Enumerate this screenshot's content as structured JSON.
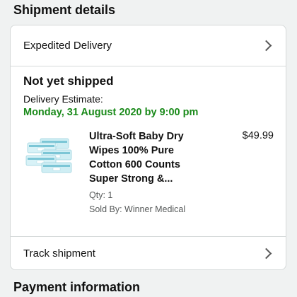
{
  "shipment": {
    "title": "Shipment details",
    "delivery_speed": "Expedited Delivery",
    "status": "Not yet shipped",
    "estimate_label": "Delivery Estimate:",
    "estimate_date": "Monday, 31 August 2020 by 9:00 pm",
    "track_label": "Track shipment"
  },
  "item": {
    "title": "Ultra-Soft Baby Dry Wipes 100% Pure Cotton 600 Counts Super Strong &...",
    "price": "$49.99",
    "qty": "Qty: 1",
    "sold_by": "Sold By: Winner Medical",
    "image_icon": "baby-wipes-product-image"
  },
  "payment": {
    "title": "Payment information"
  },
  "colors": {
    "estimate_date": "#1a8a1a",
    "background": "#f0f2f2",
    "card_border": "#d5d9d9"
  }
}
